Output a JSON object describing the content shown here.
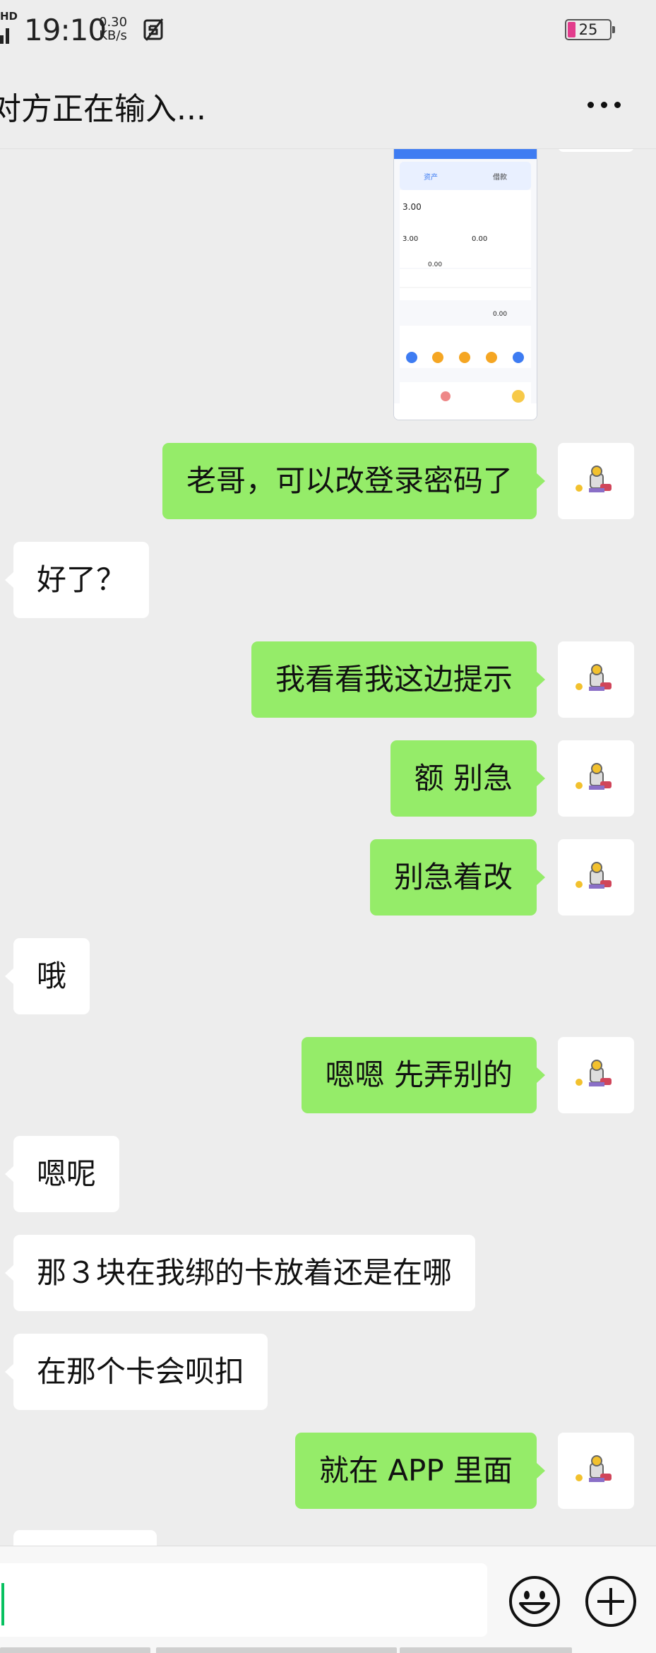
{
  "status_bar": {
    "network_type": "HD",
    "time": "19:10",
    "net_speed_value": "0.30",
    "net_speed_unit": "KB/s",
    "battery_level": "25",
    "battery_fill_fraction": 0.2
  },
  "header": {
    "title": "对方正在输入...",
    "more_icon": "more-horizontal-icon"
  },
  "messages": [
    {
      "side": "out",
      "type": "image",
      "content_desc": "app-account-screenshot"
    },
    {
      "side": "out",
      "type": "text",
      "text": "老哥，可以改登录密码了"
    },
    {
      "side": "in",
      "type": "text",
      "text": "好了？"
    },
    {
      "side": "out",
      "type": "text",
      "text": "我看看我这边提示"
    },
    {
      "side": "out",
      "type": "text",
      "text": "额 别急"
    },
    {
      "side": "out",
      "type": "text",
      "text": "别急着改"
    },
    {
      "side": "in",
      "type": "text",
      "text": "哦"
    },
    {
      "side": "out",
      "type": "text",
      "text": "嗯嗯 先弄别的"
    },
    {
      "side": "in",
      "type": "text",
      "text": "嗯呢"
    },
    {
      "side": "in",
      "type": "text",
      "text": "那３块在我绑的卡放着还是在哪"
    },
    {
      "side": "in",
      "type": "text",
      "text": "在那个卡会呗扣"
    },
    {
      "side": "out",
      "type": "text",
      "text": "就在 APP 里面"
    },
    {
      "side": "in",
      "type": "text",
      "text": ""
    }
  ],
  "screenshot_thumb": {
    "tabs": [
      "资产",
      "借款"
    ],
    "badge": "",
    "balance_label": "",
    "balance_value": "3.00",
    "balance_sub": "",
    "value_a": "3.00",
    "value_b": "0.00",
    "value_c": "0.00",
    "value_d": "0.00"
  },
  "input_bar": {
    "text_value": "",
    "emoji_icon": "emoji-smile-icon",
    "plus_icon": "plus-circle-icon"
  },
  "colors": {
    "background": "#ededed",
    "outgoing_bubble": "#95ec69",
    "incoming_bubble": "#ffffff",
    "caret": "#07c160"
  }
}
